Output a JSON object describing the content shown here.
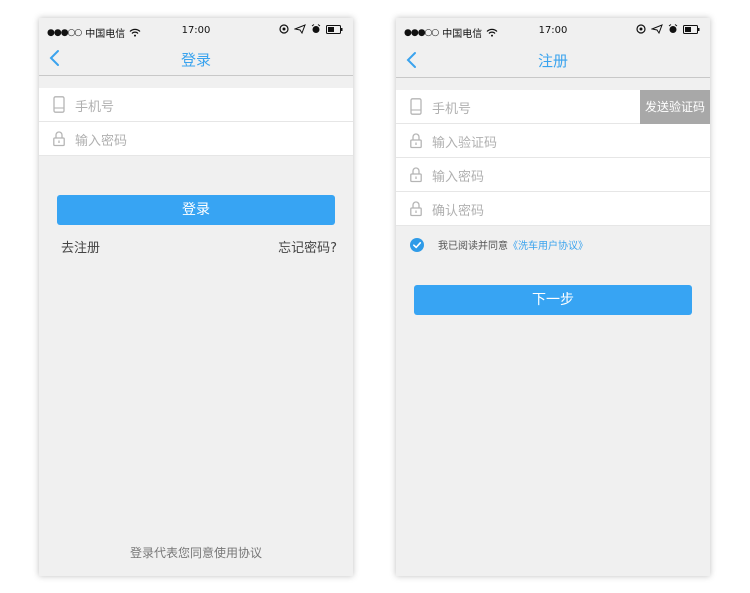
{
  "status_bar": {
    "signal": "●●●○○",
    "carrier": "中国电信",
    "time": "17:00"
  },
  "login": {
    "title": "登录",
    "phone_placeholder": "手机号",
    "password_placeholder": "输入密码",
    "login_button": "登录",
    "register_link": "去注册",
    "forgot_link": "忘记密码?",
    "footer": "登录代表您同意使用协议"
  },
  "register": {
    "title": "注册",
    "phone_placeholder": "手机号",
    "send_code_button": "发送验证码",
    "code_placeholder": "输入验证码",
    "password_placeholder": "输入密码",
    "confirm_placeholder": "确认密码",
    "agree_text": "我已阅读并同意",
    "agreement_link": "《洗车用户协议》",
    "agree_checked": true,
    "next_button": "下一步"
  },
  "colors": {
    "accent": "#37a4f3",
    "title": "#3aa3ee",
    "background": "#f0f0f0",
    "send_code_bg": "#a8a8a8"
  },
  "icons": [
    "back-chevron-icon",
    "phone-icon",
    "lock-icon",
    "wifi-icon",
    "location-icon",
    "send-icon",
    "alarm-icon",
    "battery-icon",
    "check-icon"
  ]
}
